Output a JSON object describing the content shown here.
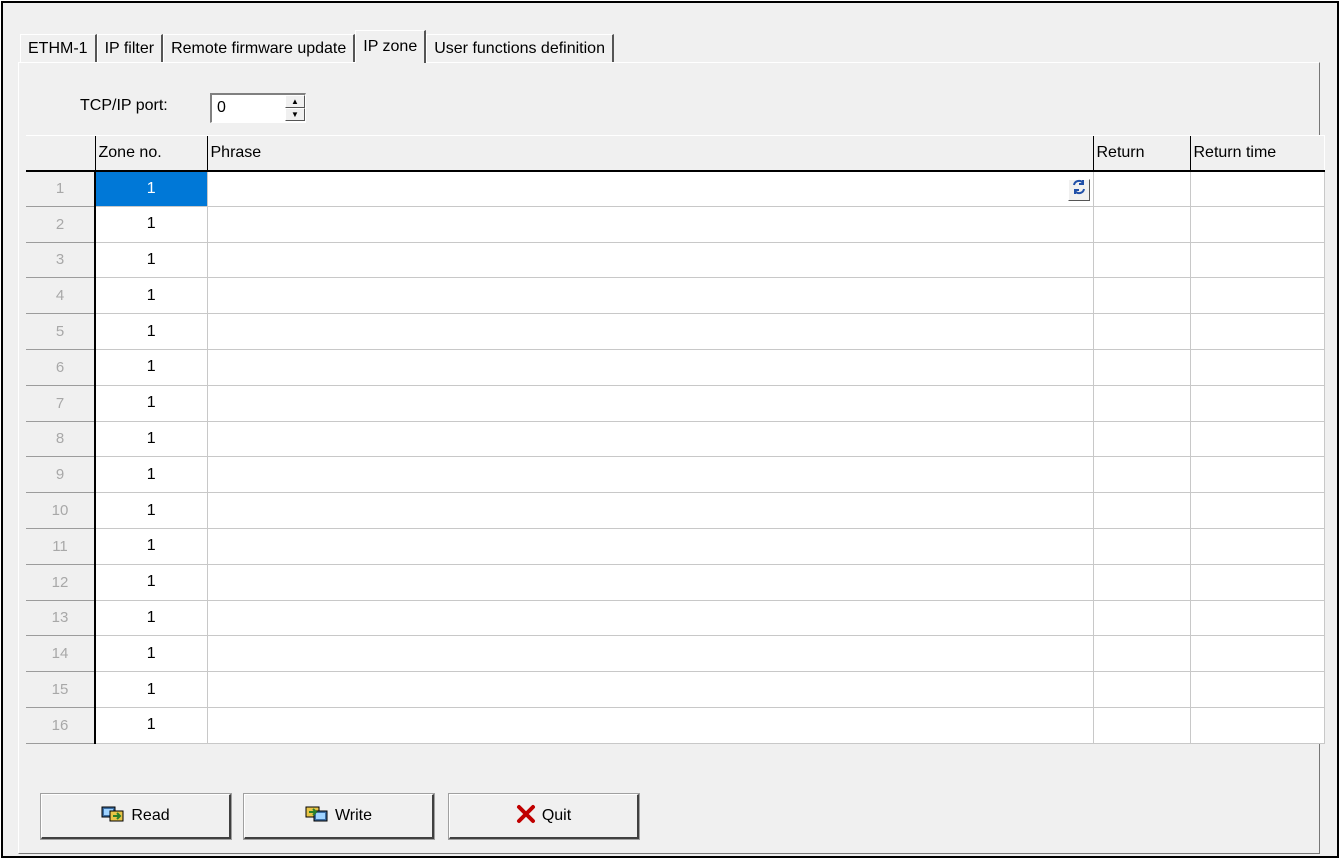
{
  "tabs": [
    {
      "label": "ETHM-1"
    },
    {
      "label": "IP filter"
    },
    {
      "label": "Remote firmware update"
    },
    {
      "label": "IP zone"
    },
    {
      "label": "User functions definition"
    }
  ],
  "active_tab": "IP zone",
  "port": {
    "label": "TCP/IP port:",
    "value": "0"
  },
  "table": {
    "columns": [
      "Zone no.",
      "Phrase",
      "Return",
      "Return time"
    ],
    "rows": [
      {
        "num": "1",
        "zone": "1"
      },
      {
        "num": "2",
        "zone": "1"
      },
      {
        "num": "3",
        "zone": "1"
      },
      {
        "num": "4",
        "zone": "1"
      },
      {
        "num": "5",
        "zone": "1"
      },
      {
        "num": "6",
        "zone": "1"
      },
      {
        "num": "7",
        "zone": "1"
      },
      {
        "num": "8",
        "zone": "1"
      },
      {
        "num": "9",
        "zone": "1"
      },
      {
        "num": "10",
        "zone": "1"
      },
      {
        "num": "11",
        "zone": "1"
      },
      {
        "num": "12",
        "zone": "1"
      },
      {
        "num": "13",
        "zone": "1"
      },
      {
        "num": "14",
        "zone": "1"
      },
      {
        "num": "15",
        "zone": "1"
      },
      {
        "num": "16",
        "zone": "1"
      }
    ]
  },
  "buttons": {
    "read": "Read",
    "write": "Write",
    "quit": "Quit"
  },
  "colors": {
    "selection": "#0078d7",
    "quit_icon": "#c00000"
  }
}
